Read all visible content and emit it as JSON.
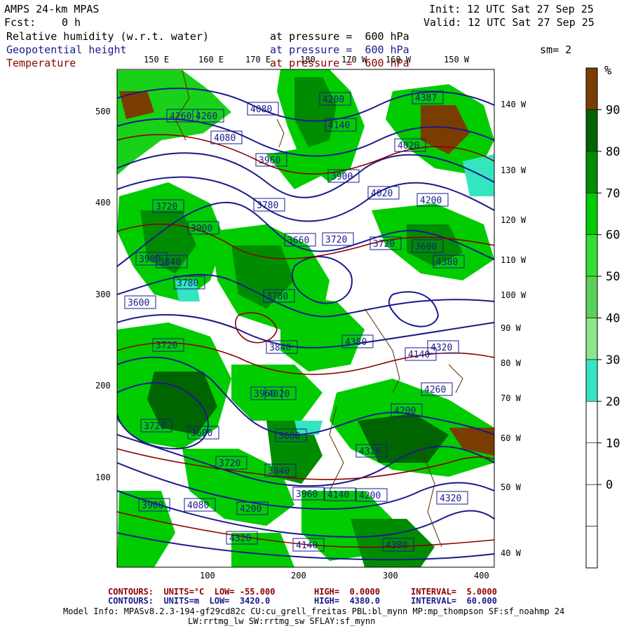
{
  "header": {
    "title": "AMPS 24-km MPAS",
    "fcst_label": "Fcst:",
    "fcst_value": "0 h",
    "init": "Init: 12 UTC Sat 27 Sep 25",
    "valid": "Valid: 12 UTC Sat 27 Sep 25",
    "smooth": "sm= 2"
  },
  "fields": [
    {
      "name": "Relative humidity (w.r.t. water)",
      "level": "at pressure =  600 hPa",
      "color": "#000000"
    },
    {
      "name": "Geopotential height",
      "level": "at pressure =  600 hPa",
      "color": "#1a1a8c"
    },
    {
      "name": "Temperature",
      "level": "at pressure =  600 hPa",
      "color": "#8b0000"
    }
  ],
  "lon_labels_top": [
    {
      "text": "150 E"
    },
    {
      "text": "160 E"
    },
    {
      "text": "170 E"
    },
    {
      "text": "180"
    },
    {
      "text": "170 W"
    },
    {
      "text": "160 W"
    },
    {
      "text": "150 W"
    }
  ],
  "lon_labels_right": [
    {
      "text": "140 W"
    },
    {
      "text": "130 W"
    },
    {
      "text": "120 W"
    },
    {
      "text": "110 W"
    },
    {
      "text": "100 W"
    },
    {
      "text": "90 W"
    },
    {
      "text": "80 W"
    },
    {
      "text": "70 W"
    },
    {
      "text": "60 W"
    },
    {
      "text": "50 W"
    },
    {
      "text": "40 W"
    }
  ],
  "axis": {
    "y_ticks": [
      "500",
      "400",
      "300",
      "200",
      "100"
    ],
    "x_ticks": [
      "100",
      "200",
      "300",
      "400"
    ]
  },
  "height_labels": [
    "4387",
    "4260",
    "4260",
    "4080",
    "4080",
    "3960",
    "4140",
    "3900",
    "4020",
    "4200",
    "4200",
    "4020",
    "3780",
    "3720",
    "3900",
    "3780",
    "3900",
    "3720",
    "3600",
    "3720",
    "3660",
    "3780",
    "3840",
    "3600",
    "3720",
    "3840",
    "4020",
    "3960",
    "3720",
    "3600",
    "3660",
    "3720",
    "3840",
    "3960",
    "4140",
    "4200",
    "4320",
    "3900",
    "4080",
    "4200",
    "4320",
    "4140",
    "4380",
    "4320",
    "4260",
    "4380",
    "4200",
    "4320",
    "4380",
    "4140"
  ],
  "colorbar": {
    "unit": "%",
    "labels": [
      "90",
      "80",
      "70",
      "60",
      "50",
      "40",
      "30",
      "20",
      "10",
      "0"
    ],
    "colors": [
      "#7a3d00",
      "#006400",
      "#008c00",
      "#00cc00",
      "#33dd33",
      "#5ad25a",
      "#8ce68c",
      "#33e6c0",
      "#ffffff",
      "#ffffff",
      "#ffffff",
      "#ffffff"
    ]
  },
  "footer": {
    "line1_a": "CONTOURS:  UNITS=°C  LOW= -55.000",
    "line1_b": "HIGH=  0.0000",
    "line1_c": "INTERVAL=  5.0000",
    "line2_a": "CONTOURS:  UNITS=m  LOW=  3420.0",
    "line2_b": "HIGH=  4380.0",
    "line2_c": "INTERVAL=  60.000",
    "model1": "Model Info: MPASv8.2.3-194-gf29cd82c CU:cu_grell_freitas PBL:bl_mynn MP:mp_thompson SF:sf_noahmp 24",
    "model2": "LW:rrtmg_lw SW:rrtmg_sw SFLAY:sf_mynn"
  },
  "colors": {
    "height": "#1a1a8c",
    "temperature": "#8b0000",
    "rh_high": "#006400",
    "rh_mid": "#00cc00",
    "rh_low": "#33e6c0"
  }
}
